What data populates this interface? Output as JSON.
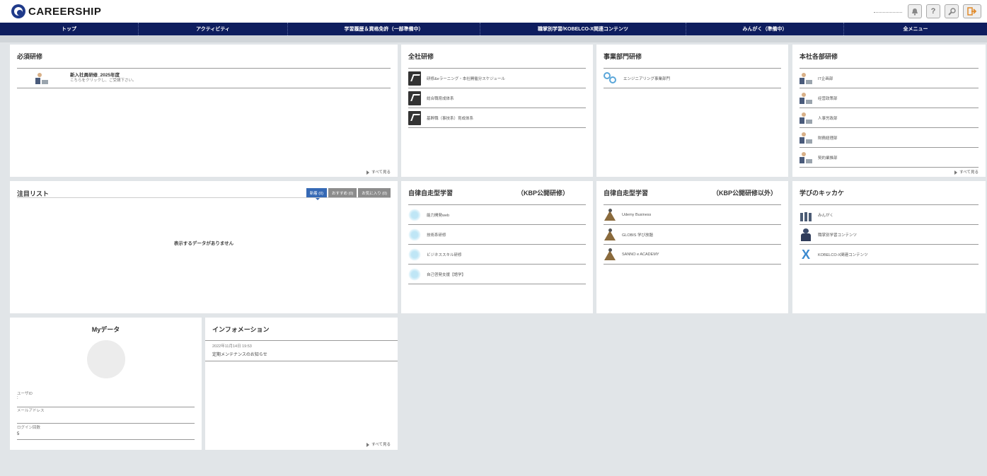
{
  "header": {
    "logo_text": "CAREERSHIP",
    "icons": [
      "bell-icon",
      "help-icon",
      "search-icon",
      "logout-icon"
    ],
    "help_glyph": "?"
  },
  "nav": {
    "items": [
      "トップ",
      "アクティビティ",
      "学習履歴＆資格免許（一部準備中）",
      "職掌別学習/KOBELCO-X関連コンテンツ",
      "みんがく（準備中）",
      "全メニュー"
    ]
  },
  "required": {
    "title": "必須研修",
    "item_title": "新入社員研修_2025年度",
    "item_sub": "こちらをクリックし、ご受講下さい。",
    "see_all": "すべて見る"
  },
  "company": {
    "title": "全社研修",
    "items": [
      "研修&eラーニング・本社開催分スケジュール",
      "総合職育成体系",
      "基幹職（事技系）育成体系"
    ]
  },
  "division": {
    "title": "事業部門研修",
    "items": [
      "エンジニアリング事業部門"
    ]
  },
  "hq": {
    "title": "本社各部研修",
    "items": [
      "IT企画部",
      "经营政策部",
      "人事労政部",
      "財務経理部",
      "契約業推部"
    ],
    "see_all": "すべて見る"
  },
  "watch": {
    "title": "注目リスト",
    "tabs": [
      "新着 (0)",
      "おすすめ (0)",
      "お気に入り (0)"
    ],
    "empty": "表示するデータがありません"
  },
  "self1": {
    "title": "自律自走型学習",
    "title_suffix": "（KBP公開研修）",
    "items": [
      "能力開発web",
      "技術系研修",
      "ビジネススキル研修",
      "自己啓発支援【語学】"
    ]
  },
  "self2": {
    "title": "自律自走型学習",
    "title_suffix": "（KBP公開研修以外）",
    "items": [
      "Udemy Business",
      "GLOBIS 学び放題",
      "SANNO e ACADEMY"
    ]
  },
  "kikkake": {
    "title": "学びのキッカケ",
    "items": [
      "みんがく",
      "職掌別学習コンテンツ",
      "KOBELCO-X関連コンテンツ"
    ]
  },
  "mydata": {
    "title": "Myデータ",
    "user_id_label": "ユーザID",
    "user_id_value": ":",
    "mail_label": "メールアドレス",
    "mail_value": "",
    "login_label": "ログイン回数",
    "login_value": "5"
  },
  "info": {
    "title": "インフォメーション",
    "date": "2022年11月14日 19:53",
    "text": "定期メンテナンスのお知らせ",
    "see_all": "すべて見る"
  },
  "colors": {
    "nav_bg": "#0e1d5e",
    "tab_active": "#3569b5",
    "background": "#e1e5e8"
  }
}
